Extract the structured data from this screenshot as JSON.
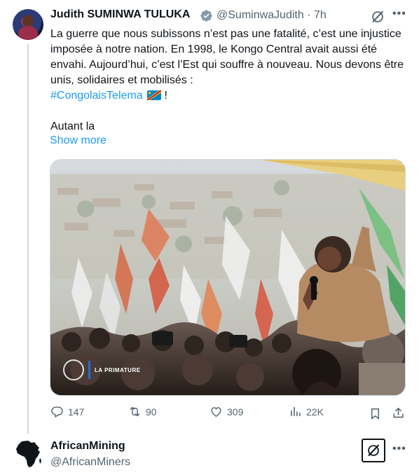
{
  "tweet": {
    "author_name": "Judith SUMINWA TULUKA",
    "author_handle": "@SuminwaJudith",
    "separator": "·",
    "time": "7h",
    "text_line1": "La guerre que nous subissons n’est pas une fatalité, c’est une injustice imposée à notre nation. En 1998, le Kongo Central avait aussi été envahi. Aujourd’hui, c’est l’Est qui souffre à nouveau. Nous devons être unis, solidaires et mobilisés :",
    "hashtag": "#CongolaisTelema",
    "hashtag_suffix": " !",
    "text_line2": "Autant la",
    "show_more": "Show more",
    "image_watermark": "LA PRIMATURE",
    "stats": {
      "replies": "147",
      "reposts": "90",
      "likes": "309",
      "views": "22K"
    }
  },
  "next_tweet": {
    "author_name": "AfricanMining",
    "author_handle": "@AfricanMiners"
  },
  "icons": {
    "verified": "verified-badge-icon",
    "grok": "grok-icon",
    "more": "more-icon",
    "reply": "reply-icon",
    "repost": "repost-icon",
    "like": "heart-icon",
    "views": "analytics-icon",
    "bookmark": "bookmark-icon",
    "share": "share-icon"
  },
  "colors": {
    "link": "#1d9bf0",
    "secondary_text": "#536471",
    "verified_badge": "#829aab"
  }
}
